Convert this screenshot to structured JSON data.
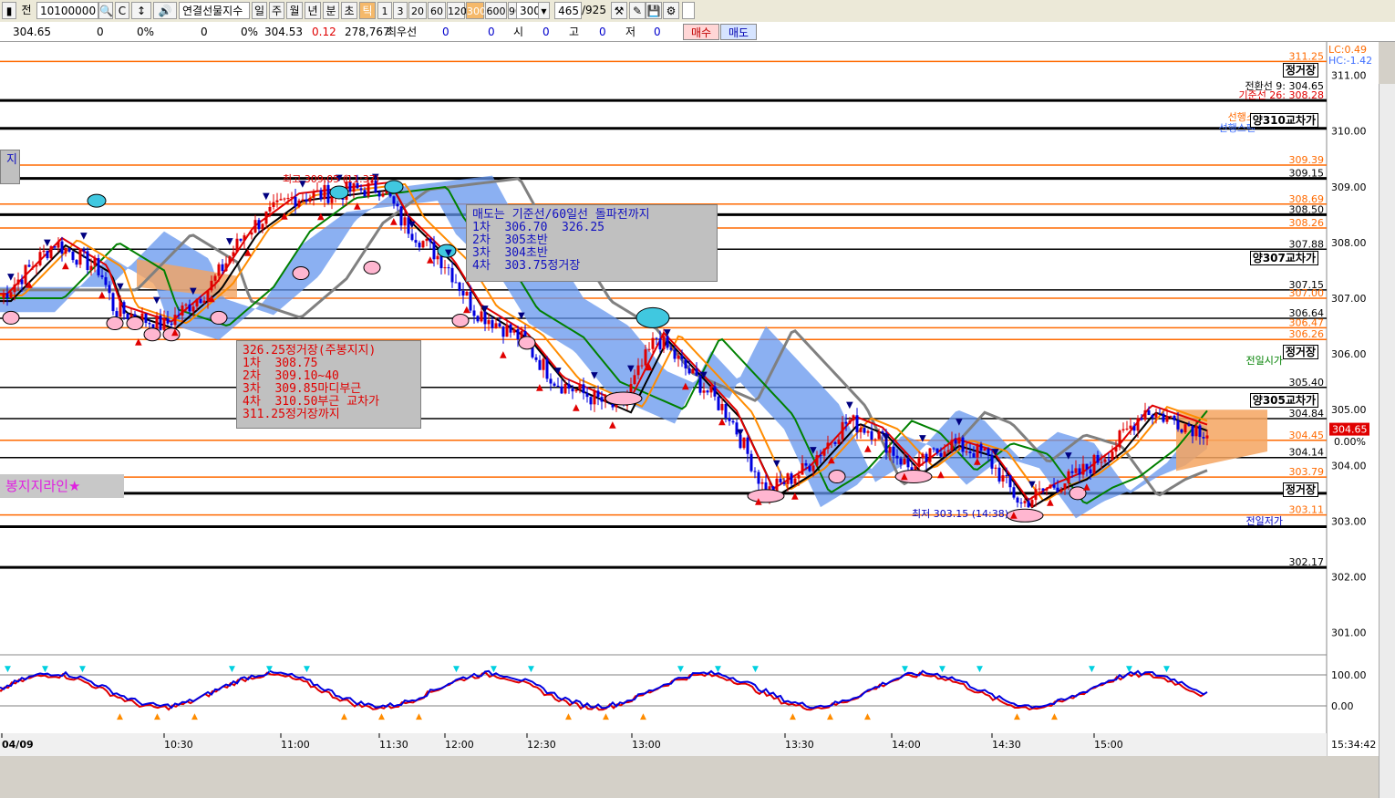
{
  "toolbar": {
    "code": "10100000",
    "name": "연결선물지수",
    "prefix": "전",
    "periods": [
      "일",
      "주",
      "월",
      "년",
      "분",
      "초",
      "틱"
    ],
    "active_period": "틱",
    "intervals": [
      "1",
      "3",
      "20",
      "60",
      "120",
      "300",
      "600",
      "900"
    ],
    "active_interval": "300",
    "interval_value": "300",
    "count": "465",
    "count_total": "/925"
  },
  "quote": {
    "price": "304.65",
    "v1": "0",
    "p1": "0%",
    "v2": "0",
    "p2": "0%",
    "last": "304.53",
    "change": "0.12",
    "volume": "278,767",
    "label_best": "최우선",
    "b1": "0",
    "b2": "0",
    "label_open": "시",
    "open": "0",
    "label_high": "고",
    "high": "0",
    "label_low": "저",
    "low": "0",
    "buy_btn": "매수",
    "sell_btn": "매도"
  },
  "annotations": {
    "sell_box": "매도는 기준선/60일선 돌파전까지\n1차  306.70  326.25\n2차  305초반\n3차  304초반\n4차  303.75정거장",
    "buy_box": "326.25정거장(주봉지지)\n1차  308.75\n2차  309.10~40\n3차  309.85마디부근\n4차  310.50부근 교차가\n311.25정거장까지",
    "left_box": "지",
    "support_label": "봉지지라인★",
    "high_label": "최고 309.05 (11:37)",
    "low_label": "최저 303.15 (14:38)",
    "right_labels": [
      "정거장",
      "양310교차가",
      "양307교차가",
      "정거장",
      "양305교차가",
      "정거장"
    ],
    "misc_labels": {
      "lc": "LC:0.49",
      "hc": "HC:-1.42",
      "conv9": "전환선 9: 304.65",
      "base26": "기준선 26: 308.28",
      "lead": "선행스",
      "lead2": "선행스팬",
      "prev_hi": "전일시가",
      "prev_lo": "전일저가",
      "pct": "0.00%",
      "cur_price": "304.65"
    }
  },
  "price_axis": [
    "311.00",
    "310.00",
    "309.00",
    "308.00",
    "307.00",
    "306.00",
    "305.00",
    "304.00",
    "303.00",
    "302.00",
    "301.00"
  ],
  "level_labels": [
    {
      "t": "311.25",
      "c": "#ff6a00"
    },
    {
      "t": "309.39",
      "c": "#ff6a00"
    },
    {
      "t": "309.15",
      "c": "#000"
    },
    {
      "t": "308.69",
      "c": "#ff6a00"
    },
    {
      "t": "308.50",
      "c": "#000"
    },
    {
      "t": "308.26",
      "c": "#ff6a00"
    },
    {
      "t": "307.88",
      "c": "#000"
    },
    {
      "t": "307.15",
      "c": "#000"
    },
    {
      "t": "307.00",
      "c": "#ff6a00"
    },
    {
      "t": "306.64",
      "c": "#000"
    },
    {
      "t": "306.47",
      "c": "#ff6a00"
    },
    {
      "t": "306.26",
      "c": "#ff6a00"
    },
    {
      "t": "305.40",
      "c": "#000"
    },
    {
      "t": "304.84",
      "c": "#000"
    },
    {
      "t": "304.45",
      "c": "#ff6a00"
    },
    {
      "t": "304.14",
      "c": "#000"
    },
    {
      "t": "303.79",
      "c": "#ff6a00"
    },
    {
      "t": "303.11",
      "c": "#ff6a00"
    },
    {
      "t": "302.17",
      "c": "#000"
    }
  ],
  "osc_axis": [
    "100.00",
    "0.00"
  ],
  "time_axis": [
    "04/09",
    "10:30",
    "11:00",
    "11:30",
    "12:00",
    "12:30",
    "13:00",
    "13:30",
    "14:00",
    "14:30",
    "15:00"
  ],
  "clock": "15:34:42",
  "colors": {
    "orange": "#ff6a00",
    "cloud": "#6495ed",
    "cloud2": "#f4a460",
    "sma60": "#808080",
    "ma": "#008000"
  }
}
